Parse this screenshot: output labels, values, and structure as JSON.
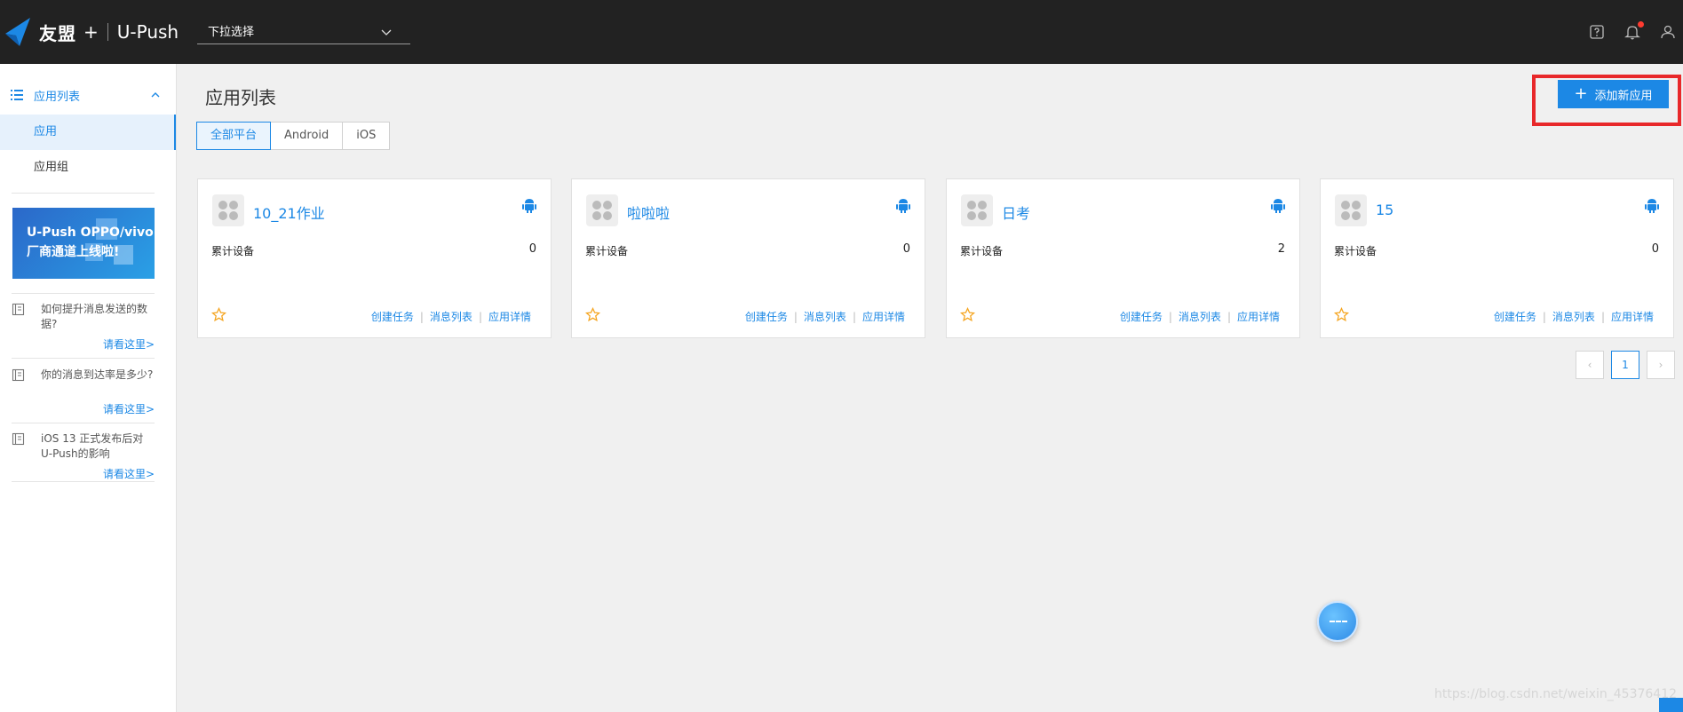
{
  "header": {
    "brand": "友盟",
    "brand_plus": "+",
    "product": "U-Push",
    "app_select_placeholder": "下拉选择"
  },
  "sidebar": {
    "group_label": "应用列表",
    "items": [
      {
        "label": "应用",
        "active": true
      },
      {
        "label": "应用组",
        "active": false
      }
    ],
    "banner": {
      "line1": "U-Push OPPO/vivo",
      "line2": "厂商通道上线啦!"
    },
    "tips": [
      {
        "text": "如何提升消息发送的数据?",
        "link": "请看这里>"
      },
      {
        "text": "你的消息到达率是多少?",
        "link": "请看这里>"
      },
      {
        "text": "iOS 13 正式发布后对U-Push的影响",
        "link": "请看这里>"
      }
    ]
  },
  "main": {
    "title": "应用列表",
    "platform_tabs": [
      {
        "label": "全部平台",
        "active": true
      },
      {
        "label": "Android",
        "active": false
      },
      {
        "label": "iOS",
        "active": false
      }
    ],
    "add_button_label": "添加新应用",
    "add_button_plus": "+",
    "apps": [
      {
        "name": "10_21作业",
        "stat_label": "累计设备",
        "stat_value": "0",
        "links": [
          "创建任务",
          "消息列表",
          "应用详情"
        ]
      },
      {
        "name": "啦啦啦",
        "stat_label": "累计设备",
        "stat_value": "0",
        "links": [
          "创建任务",
          "消息列表",
          "应用详情"
        ]
      },
      {
        "name": "日考",
        "stat_label": "累计设备",
        "stat_value": "2",
        "links": [
          "创建任务",
          "消息列表",
          "应用详情"
        ]
      },
      {
        "name": "15",
        "stat_label": "累计设备",
        "stat_value": "0",
        "links": [
          "创建任务",
          "消息列表",
          "应用详情"
        ]
      }
    ],
    "pagination": {
      "prev": "‹",
      "current": "1",
      "next": "›"
    }
  },
  "watermark": "https://blog.csdn.net/weixin_45376412",
  "colors": {
    "accent": "#1c88e5",
    "header_bg": "#222222",
    "highlight_box": "#e8282a",
    "star": "#f5a623"
  }
}
